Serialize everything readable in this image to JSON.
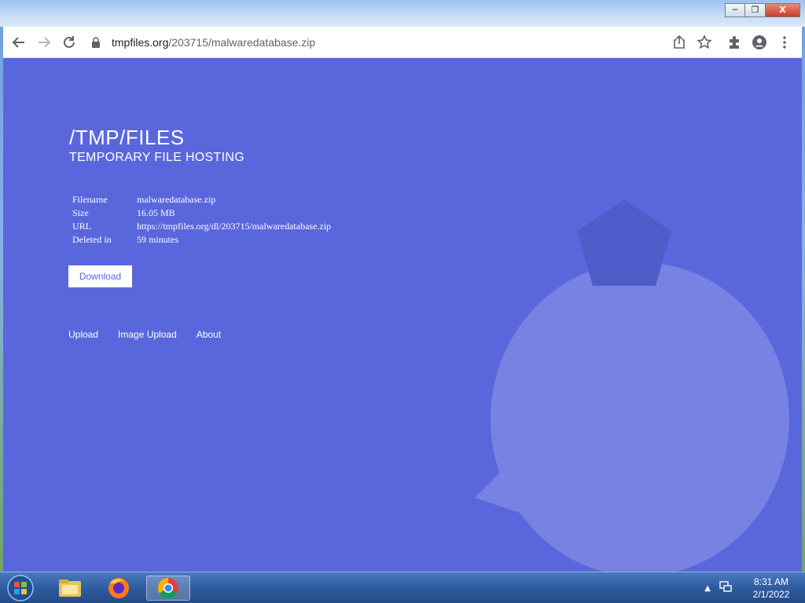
{
  "window": {
    "minimize_glyph": "─",
    "restore_glyph": "❐",
    "close_glyph": "X"
  },
  "browser": {
    "url_domain": "tmpfiles.org",
    "url_path": "/203715/malwaredatabase.zip",
    "icons": [
      "back-icon",
      "forward-icon",
      "reload-icon",
      "lock-icon",
      "share-icon",
      "star-icon",
      "extensions-icon",
      "profile-icon",
      "menu-icon"
    ]
  },
  "page": {
    "title": "/TMP/FILES",
    "subtitle": "TEMPORARY FILE HOSTING",
    "info": [
      {
        "label": "Filename",
        "value": "malwaredatabase.zip"
      },
      {
        "label": "Size",
        "value": "16.05 MB"
      },
      {
        "label": "URL",
        "value": "https://tmpfiles.org/dl/203715/malwaredatabase.zip"
      },
      {
        "label": "Deleted in",
        "value": "59 minutes"
      }
    ],
    "download_label": "Download",
    "nav": {
      "upload": "Upload",
      "image_upload": "Image Upload",
      "about": "About"
    }
  },
  "taskbar": {
    "apps": [
      "windows-explorer",
      "firefox",
      "chrome"
    ],
    "time": "8:31 AM",
    "date": "2/1/2022"
  },
  "colors": {
    "page_bg": "#5a67dc",
    "button_text": "#5a67dc",
    "taskbar": "#2f5c9f"
  }
}
